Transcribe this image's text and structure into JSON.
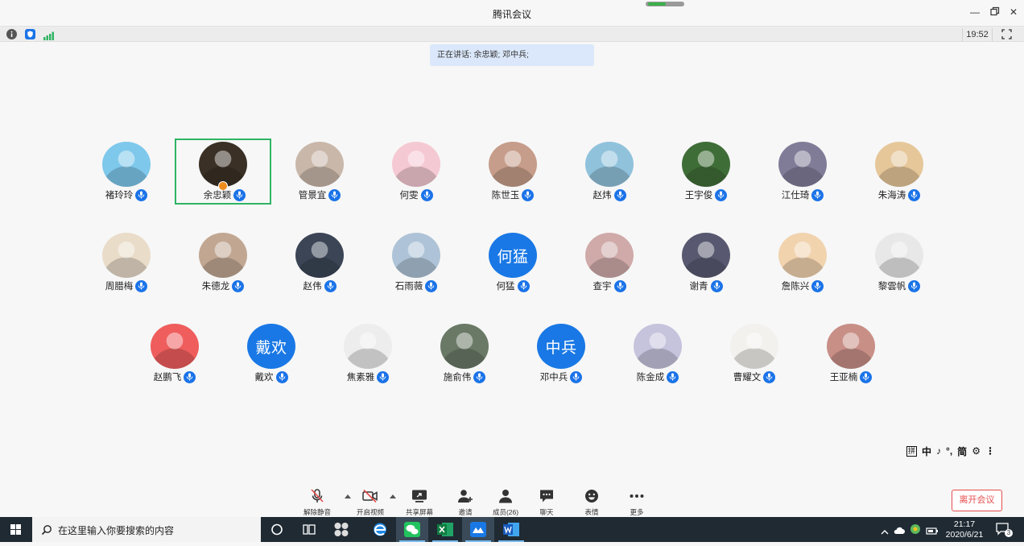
{
  "window": {
    "title": "腾讯会议",
    "clock": "19:52"
  },
  "speaking": {
    "text": "正在讲话: 余忠颖; 邓中兵;"
  },
  "participants": [
    {
      "name": "褚玲玲",
      "color": "#7ec8ec",
      "avatar_text": ""
    },
    {
      "name": "余忠颖",
      "color": "#3a3026",
      "avatar_text": "",
      "active": true,
      "host": true
    },
    {
      "name": "管景宜",
      "color": "#c9b7a9",
      "avatar_text": ""
    },
    {
      "name": "何雯",
      "color": "#f5c9d3",
      "avatar_text": ""
    },
    {
      "name": "陈世玉",
      "color": "#c69d8a",
      "avatar_text": ""
    },
    {
      "name": "赵炜",
      "color": "#90c2dc",
      "avatar_text": ""
    },
    {
      "name": "王宇俊",
      "color": "#3f6d37",
      "avatar_text": ""
    },
    {
      "name": "江仕琦",
      "color": "#807c98",
      "avatar_text": ""
    },
    {
      "name": "朱海涛",
      "color": "#e6c79a",
      "avatar_text": ""
    },
    {
      "name": "周腊梅",
      "color": "#e9dcc9",
      "avatar_text": ""
    },
    {
      "name": "朱德龙",
      "color": "#c1a792",
      "avatar_text": ""
    },
    {
      "name": "赵伟",
      "color": "#3b4556",
      "avatar_text": ""
    },
    {
      "name": "石雨薇",
      "color": "#aec3d7",
      "avatar_text": ""
    },
    {
      "name": "何猛",
      "color": "#1978e5",
      "avatar_text": "何猛"
    },
    {
      "name": "查宇",
      "color": "#cfaaa9",
      "avatar_text": ""
    },
    {
      "name": "谢青",
      "color": "#585970",
      "avatar_text": ""
    },
    {
      "name": "詹陈兴",
      "color": "#f1d3ae",
      "avatar_text": ""
    },
    {
      "name": "黎雲帆",
      "color": "#e8e8e8",
      "avatar_text": ""
    },
    {
      "name": "赵鹏飞",
      "color": "#ef5d5d",
      "avatar_text": ""
    },
    {
      "name": "戴欢",
      "color": "#1978e5",
      "avatar_text": "戴欢"
    },
    {
      "name": "焦素雅",
      "color": "#ededed",
      "avatar_text": ""
    },
    {
      "name": "施俞伟",
      "color": "#6a7966",
      "avatar_text": ""
    },
    {
      "name": "邓中兵",
      "color": "#1978e5",
      "avatar_text": "中兵"
    },
    {
      "name": "陈金成",
      "color": "#c6c3dd",
      "avatar_text": ""
    },
    {
      "name": "曹耀文",
      "color": "#f3f1ee",
      "avatar_text": ""
    },
    {
      "name": "王亚楠",
      "color": "#c88f87",
      "avatar_text": ""
    }
  ],
  "ime": {
    "items": [
      "拼",
      "中",
      "♪",
      "°,",
      "简",
      "⚙",
      "⋮"
    ]
  },
  "toolbar": {
    "unmute": "解除静音",
    "start_video": "开启视频",
    "share_screen": "共享屏幕",
    "invite": "邀请",
    "members": "成员(26)",
    "chat": "聊天",
    "emoji": "表情",
    "more": "更多",
    "leave": "离开会议"
  },
  "taskbar": {
    "search_placeholder": "在这里输入你要搜索的内容",
    "time": "21:17",
    "date": "2020/6/21",
    "notifications": "3"
  }
}
